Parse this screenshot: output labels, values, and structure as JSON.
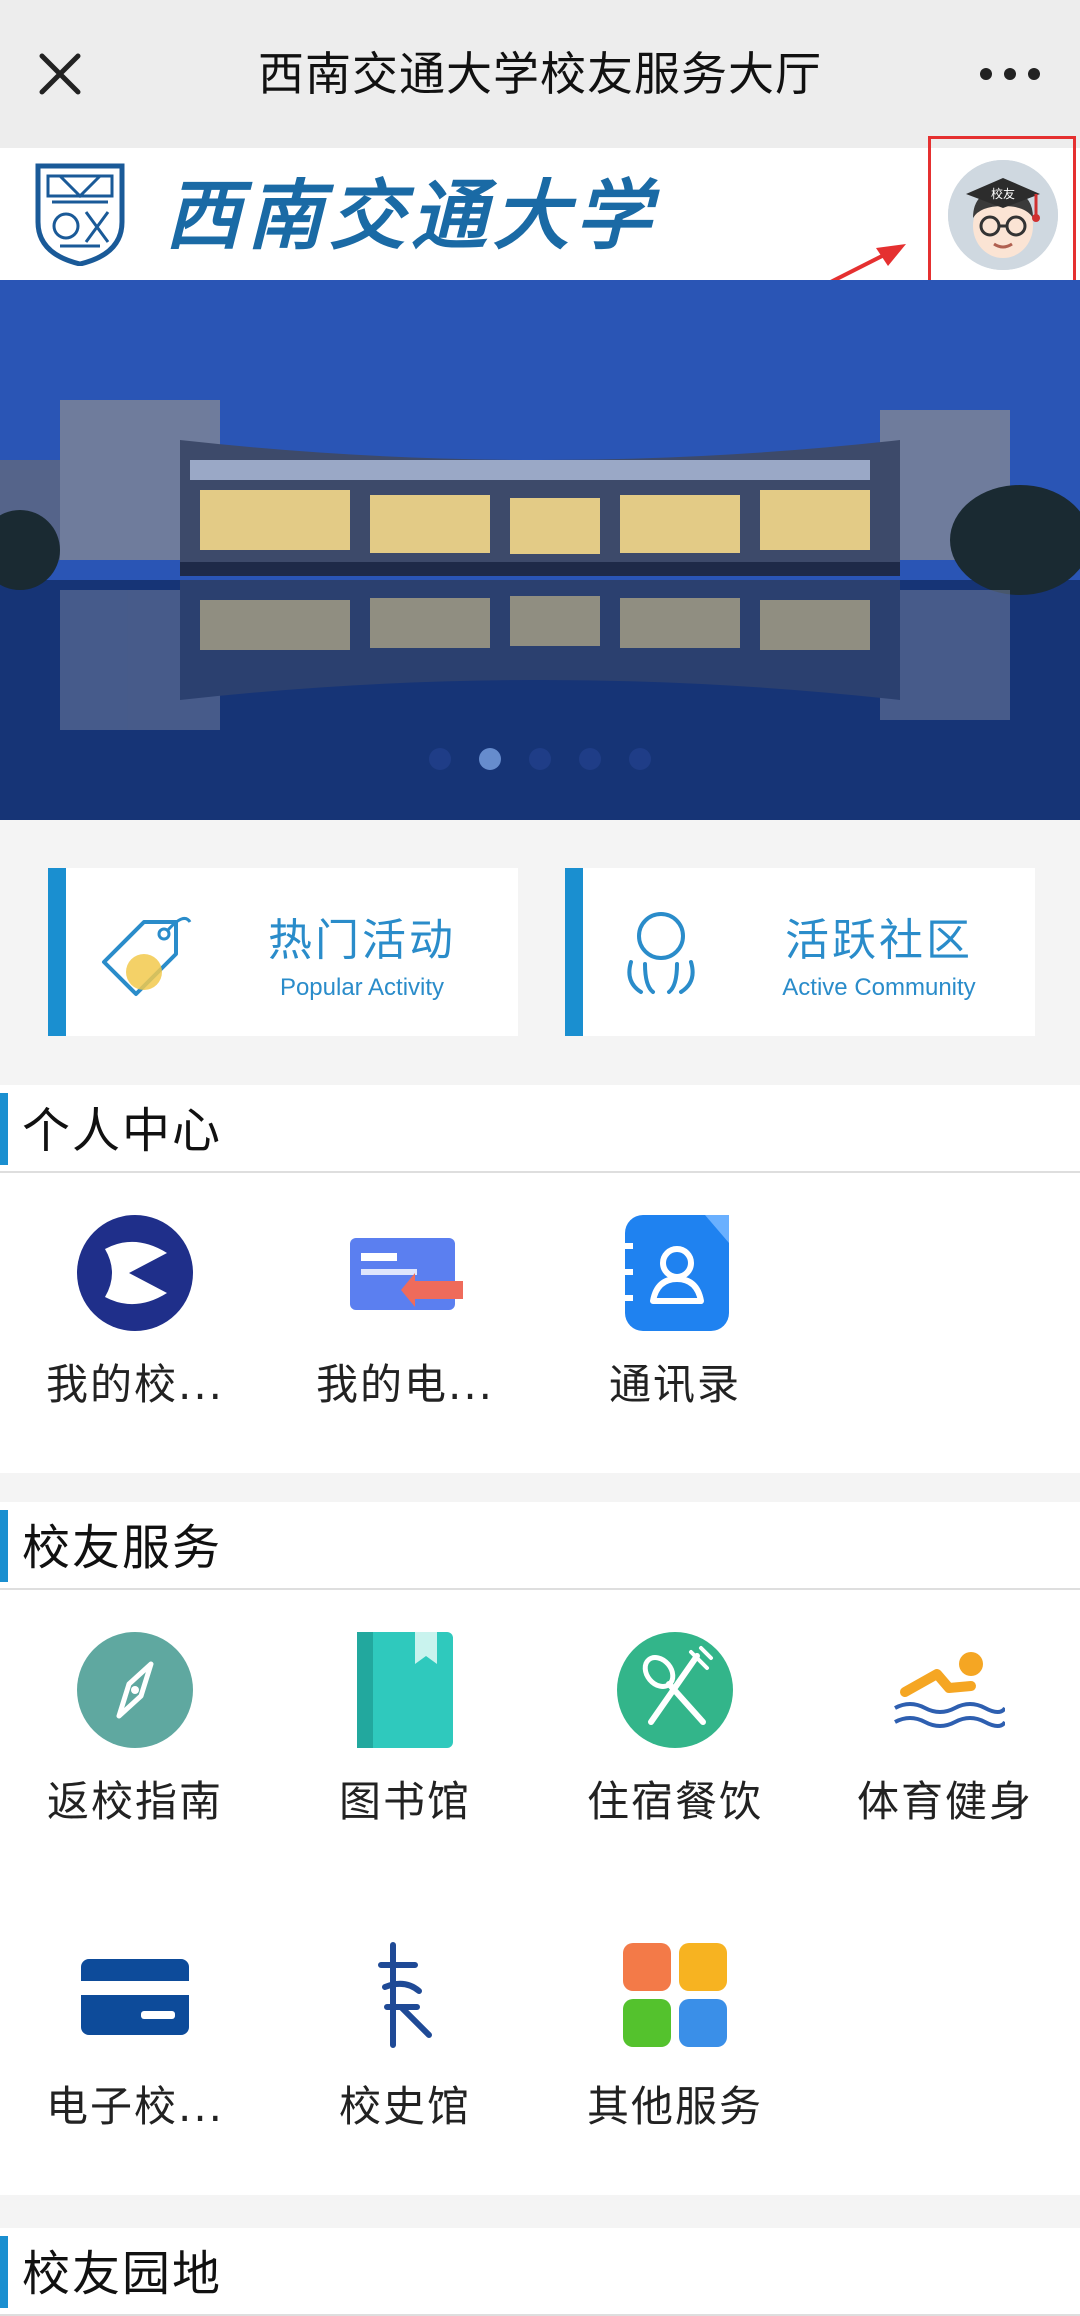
{
  "titlebar": {
    "title": "西南交通大学校友服务大厅",
    "close_icon": "close-icon",
    "more_icon": "more-icon"
  },
  "header": {
    "school_name": "西南交通大学",
    "avatar_badge": "校友"
  },
  "banner": {
    "dot_count": 5,
    "active_dot": 2
  },
  "cards": [
    {
      "cn": "热门活动",
      "en": "Popular Activity",
      "icon": "tag-icon"
    },
    {
      "cn": "活跃社区",
      "en": "Active Community",
      "icon": "community-icon"
    }
  ],
  "personal": {
    "title": "个人中心",
    "items": [
      {
        "label": "我的校...",
        "icon": "play-circle-icon"
      },
      {
        "label": "我的电...",
        "icon": "ecard-arrow-icon"
      },
      {
        "label": "通讯录",
        "icon": "contacts-icon"
      }
    ]
  },
  "services": {
    "title": "校友服务",
    "items": [
      {
        "label": "返校指南",
        "icon": "compass-icon"
      },
      {
        "label": "图书馆",
        "icon": "book-icon"
      },
      {
        "label": "住宿餐饮",
        "icon": "dining-icon"
      },
      {
        "label": "体育健身",
        "icon": "swimming-icon"
      },
      {
        "label": "电子校...",
        "icon": "card-icon"
      },
      {
        "label": "校史馆",
        "icon": "history-icon"
      },
      {
        "label": "其他服务",
        "icon": "apps-icon"
      }
    ]
  },
  "garden": {
    "title": "校友园地"
  },
  "colors": {
    "accent": "#1a8fd0",
    "highlight": "#e53030",
    "banner": "#2c56b8"
  }
}
